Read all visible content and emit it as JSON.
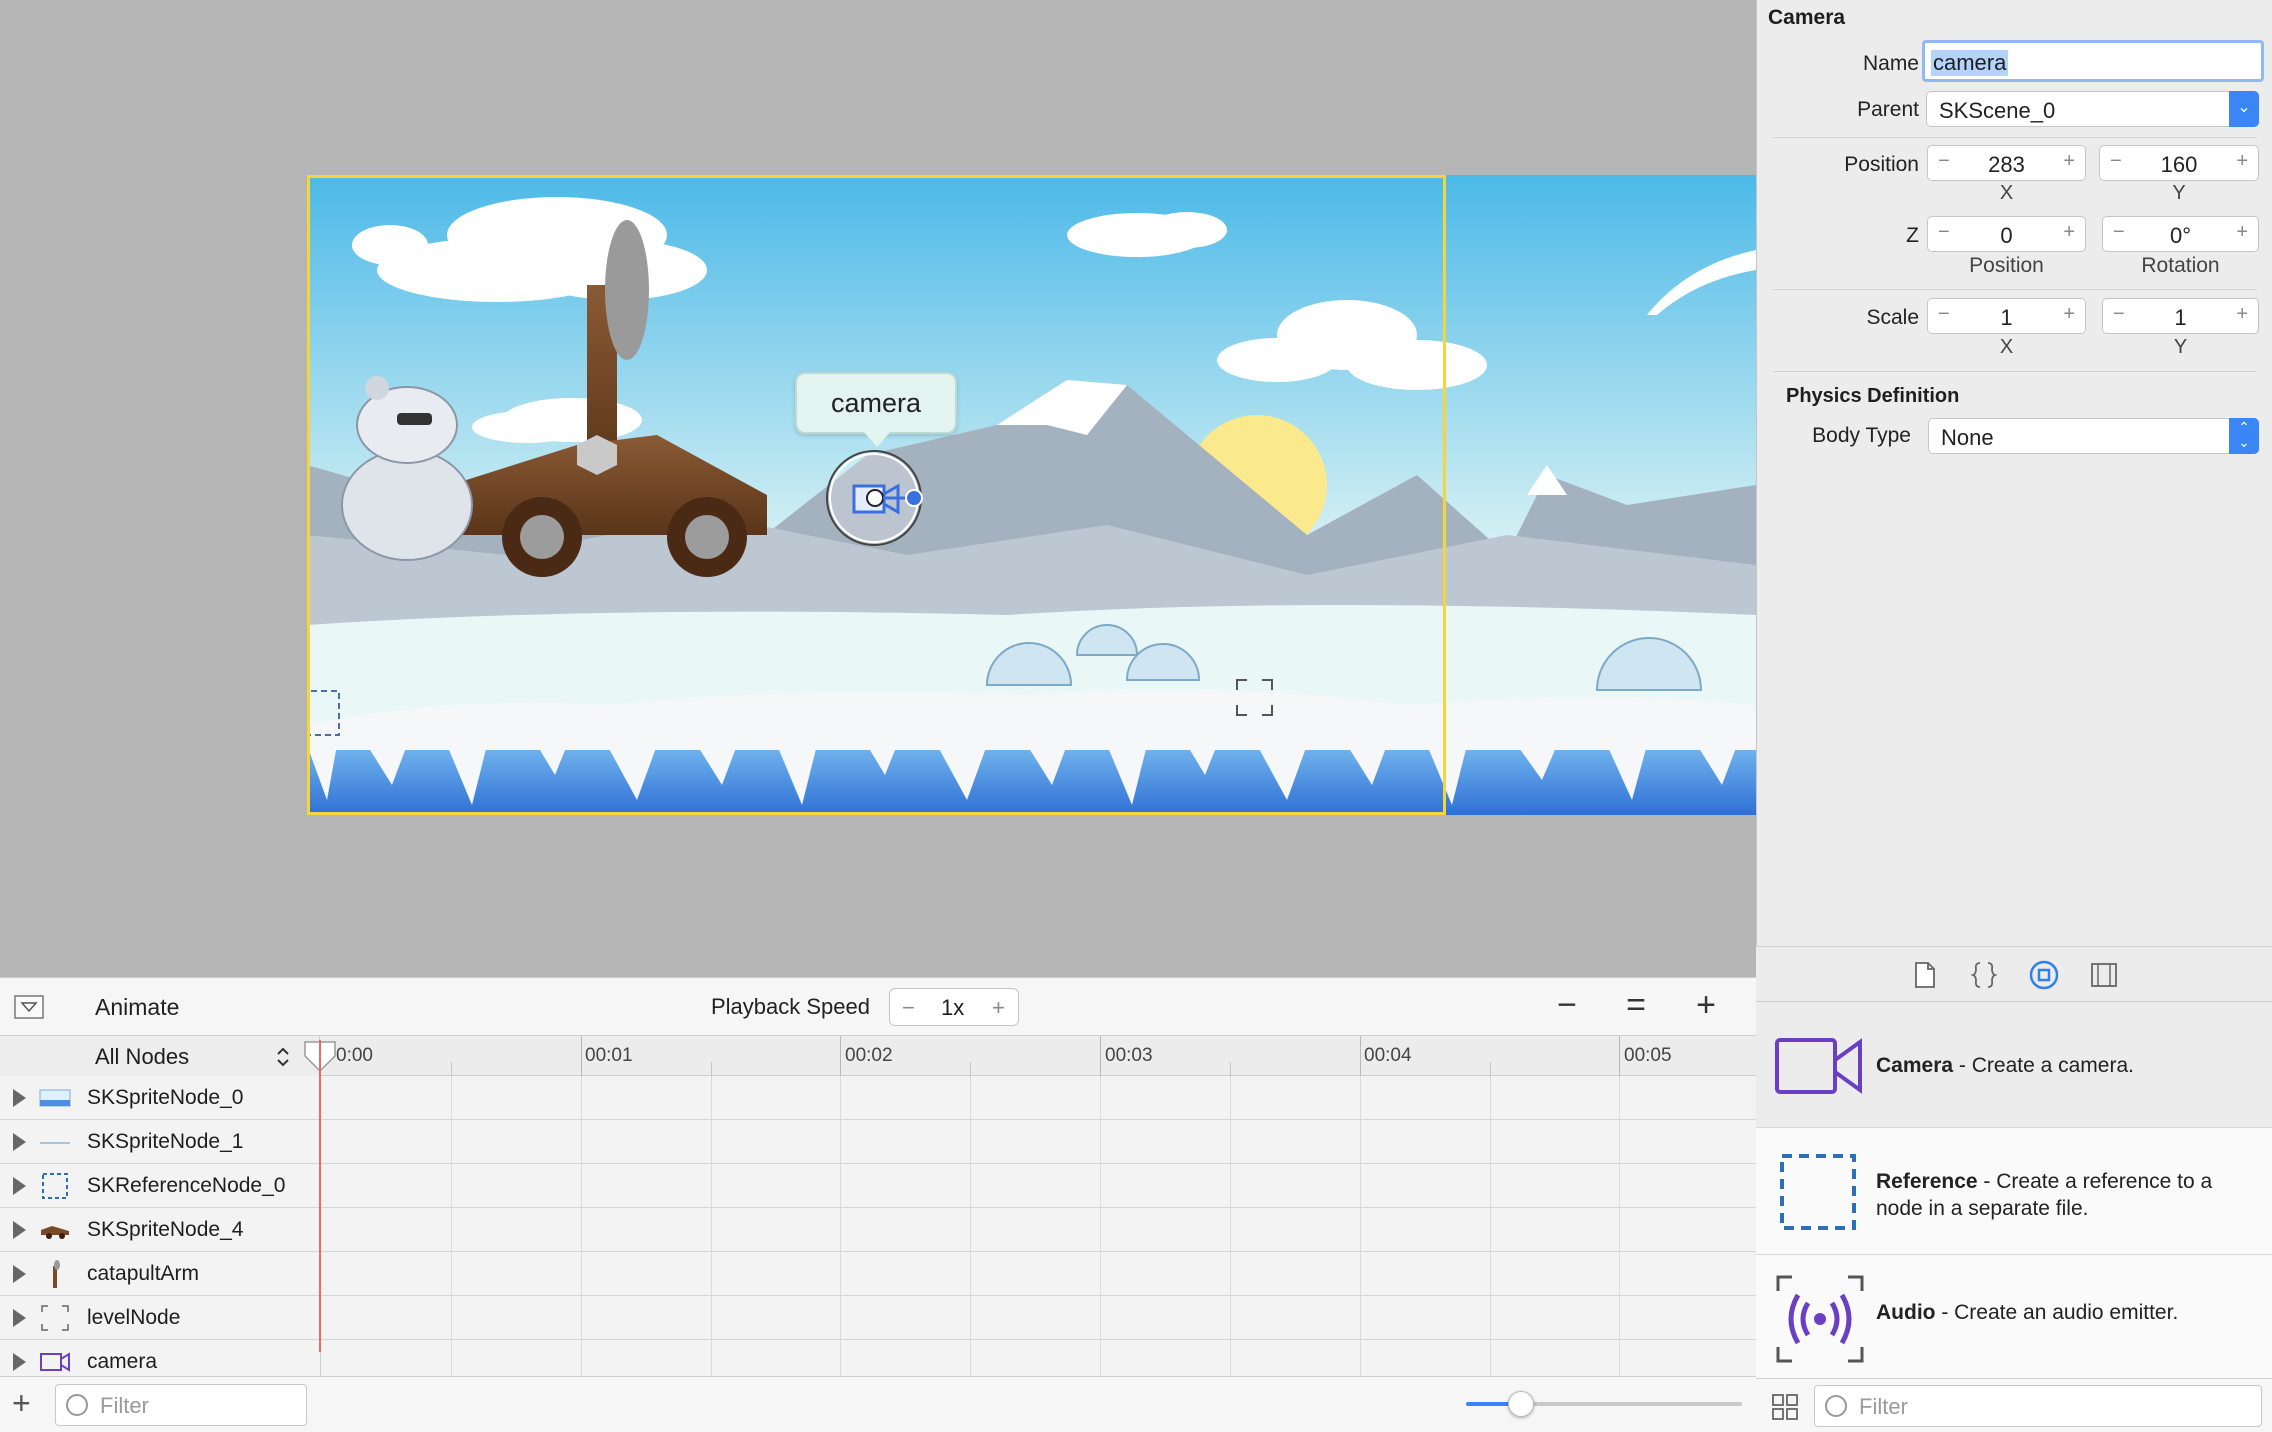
{
  "scene": {
    "callout_label": "camera"
  },
  "timeline": {
    "animate_label": "Animate",
    "playback_label": "Playback Speed",
    "speed_minus": "−",
    "speed_value": "1x",
    "speed_plus": "+",
    "zoom_out": "−",
    "zoom_fit": "=",
    "zoom_in": "+",
    "node_filter": "All Nodes",
    "ruler_labels": [
      "0:00",
      "00:01",
      "00:02",
      "00:03",
      "00:04",
      "00:05"
    ],
    "nodes": [
      {
        "name": "SKSpriteNode_0",
        "icon": "ice-sprite-icon"
      },
      {
        "name": "SKSpriteNode_1",
        "icon": "line-sprite-icon"
      },
      {
        "name": "SKReferenceNode_0",
        "icon": "reference-icon"
      },
      {
        "name": "SKSpriteNode_4",
        "icon": "cart-sprite-icon"
      },
      {
        "name": "catapultArm",
        "icon": "arm-sprite-icon"
      },
      {
        "name": "levelNode",
        "icon": "node-icon"
      },
      {
        "name": "camera",
        "icon": "camera-icon"
      }
    ],
    "add_label": "+",
    "filter_placeholder": "Filter",
    "zoom_level": 0.2
  },
  "inspector": {
    "section_title": "Camera",
    "name_label": "Name",
    "name_value": "camera",
    "parent_label": "Parent",
    "parent_value": "SKScene_0",
    "position_label": "Position",
    "position_x": "283",
    "position_y": "160",
    "x_label": "X",
    "y_label": "Y",
    "z_label": "Z",
    "z_position": "0",
    "rotation": "0°",
    "z_position_sub": "Position",
    "rotation_sub": "Rotation",
    "scale_label": "Scale",
    "scale_x": "1",
    "scale_y": "1",
    "physics_title": "Physics Definition",
    "body_type_label": "Body Type",
    "body_type_value": "None",
    "stepper_minus": "−",
    "stepper_plus": "+"
  },
  "library": {
    "items": [
      {
        "title": "Camera",
        "desc": " - Create a camera."
      },
      {
        "title": "Reference",
        "desc": " - Create a reference to a node in a separate file."
      },
      {
        "title": "Audio",
        "desc": " - Create an audio emitter."
      }
    ],
    "filter_placeholder": "Filter"
  },
  "colors": {
    "accent": "#3b86f7",
    "playhead": "#e86a6a",
    "scene_border": "#f4d63b",
    "camera_purple": "#6b3fc4"
  }
}
